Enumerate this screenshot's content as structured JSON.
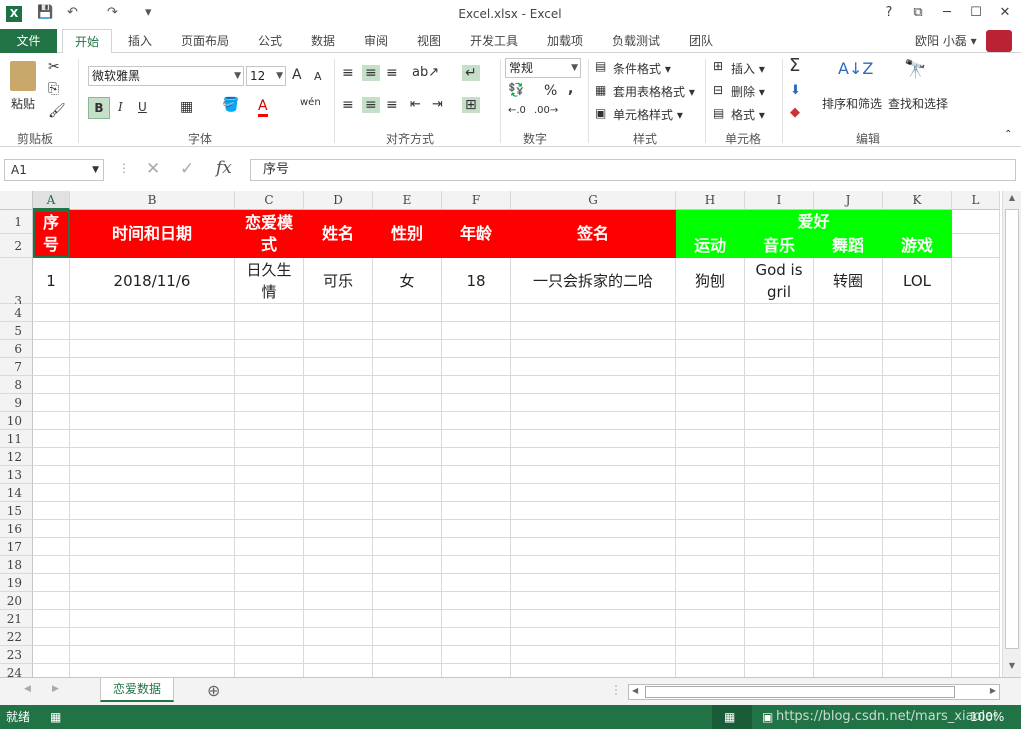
{
  "window": {
    "title": "Excel.xlsx - Excel",
    "help": "?",
    "ribbon_opts": "⧉",
    "minimize": "─",
    "maximize": "☐",
    "close": "✕"
  },
  "qat": {
    "save": "💾",
    "undo": "↶",
    "redo": "↷",
    "more": "▾"
  },
  "tabs": [
    {
      "label": "文件"
    },
    {
      "label": "开始"
    },
    {
      "label": "插入"
    },
    {
      "label": "页面布局"
    },
    {
      "label": "公式"
    },
    {
      "label": "数据"
    },
    {
      "label": "审阅"
    },
    {
      "label": "视图"
    },
    {
      "label": "开发工具"
    },
    {
      "label": "加载项"
    },
    {
      "label": "负载测试"
    },
    {
      "label": "团队"
    }
  ],
  "user": {
    "name": "欧阳 小磊"
  },
  "ribbon": {
    "clipboard": {
      "label": "剪贴板",
      "paste": "粘贴"
    },
    "font": {
      "label": "字体",
      "name": "微软雅黑",
      "size": "12",
      "bold": "B",
      "italic": "I",
      "underline": "U",
      "grow": "A",
      "shrink": "A",
      "color": "A",
      "wen": "wén"
    },
    "align": {
      "label": "对齐方式"
    },
    "number": {
      "label": "数字",
      "format": "常规",
      "percent": "%",
      "comma": ","
    },
    "styles": {
      "label": "样式",
      "cond": "条件格式",
      "table": "套用表格格式",
      "cell": "单元格样式"
    },
    "cells": {
      "label": "单元格",
      "insert": "插入",
      "delete": "删除",
      "format": "格式"
    },
    "edit": {
      "label": "编辑",
      "sort": "排序和筛选",
      "find": "查找和选择",
      "sigma": "Σ"
    }
  },
  "formula_bar": {
    "name_box": "A1",
    "fx": "fx",
    "content": "序号"
  },
  "columns": [
    "A",
    "B",
    "C",
    "D",
    "E",
    "F",
    "G",
    "H",
    "I",
    "J",
    "K",
    "L"
  ],
  "rows": [
    "1",
    "2",
    "3",
    "4",
    "5",
    "6",
    "7",
    "8",
    "9",
    "10",
    "11",
    "12",
    "13",
    "14",
    "15",
    "16",
    "17",
    "18",
    "19",
    "20",
    "21",
    "22",
    "23",
    "24"
  ],
  "header": {
    "seq": "序号",
    "datetime": "时间和日期",
    "mode": "恋爱模式",
    "name": "姓名",
    "gender": "性别",
    "age": "年龄",
    "sign": "签名",
    "hobby": "爱好",
    "sport": "运动",
    "music": "音乐",
    "dance": "舞蹈",
    "game": "游戏"
  },
  "record": {
    "seq": "1",
    "datetime": "2018/11/6",
    "mode": "日久生情",
    "name": "可乐",
    "gender": "女",
    "age": "18",
    "sign": "一只会拆家的二哈",
    "sport": "狗刨",
    "music": "God is gril",
    "dance": "转圈",
    "game": "LOL"
  },
  "sheet": {
    "tab": "恋爱数据",
    "add": "⊕"
  },
  "status": {
    "ready": "就绪",
    "zoom": "100%",
    "watermark": "https://blog.csdn.net/mars_xiaolei"
  },
  "colors": {
    "brand": "#217346",
    "red": "#ff0000",
    "green": "#00ff00"
  }
}
